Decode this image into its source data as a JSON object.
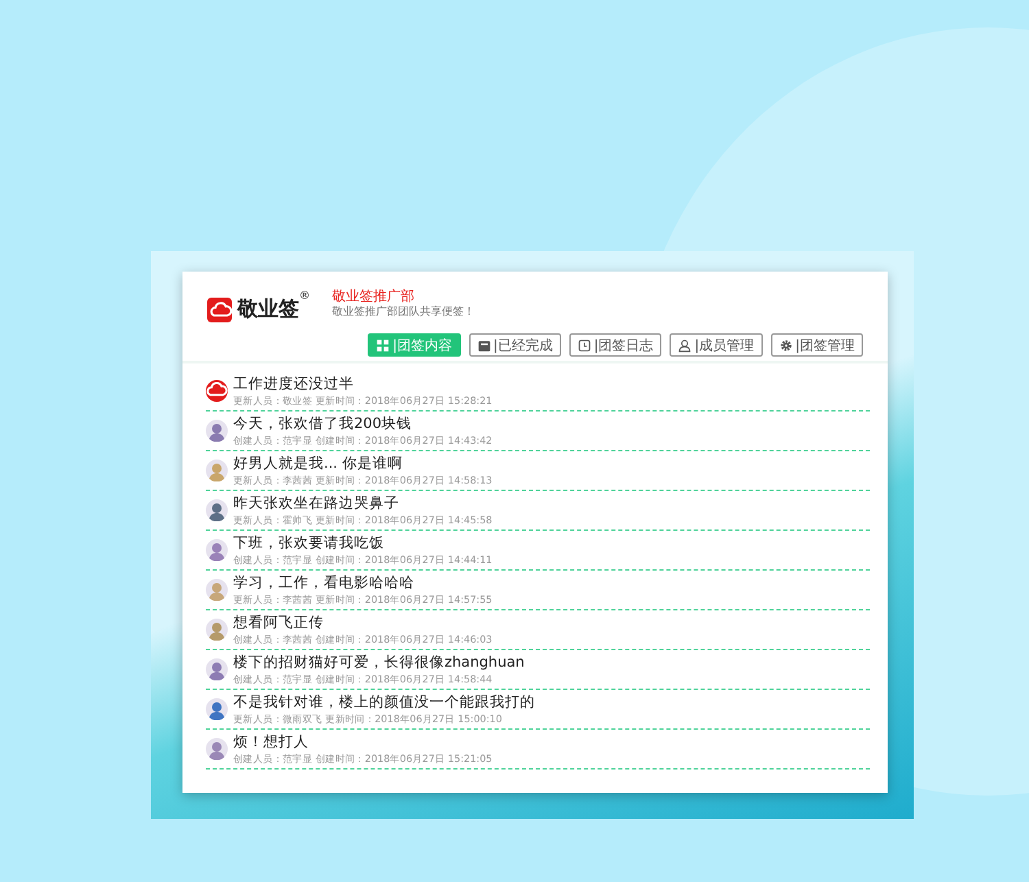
{
  "brand": {
    "name": "敬业签",
    "mark": "®",
    "team": "敬业签推广部",
    "slogan": "敬业签推广部团队共享便签！"
  },
  "tabs": [
    {
      "label": "|团签内容",
      "kind": "grid",
      "selected": true
    },
    {
      "label": "|已经完成",
      "kind": "box",
      "selected": false
    },
    {
      "label": "|团签日志",
      "kind": "log",
      "selected": false
    },
    {
      "label": "|成员管理",
      "kind": "user",
      "selected": false
    },
    {
      "label": "|团签管理",
      "kind": "gear",
      "selected": false
    }
  ],
  "notes": [
    {
      "title": "工作进度还没过半",
      "meta": "更新人员：敬业签 更新时间：2018年06月27日 15:28:21",
      "kind": "logo"
    },
    {
      "title": "今天，张欢借了我200块钱",
      "meta": "创建人员：范宇显 创建时间：2018年06月27日 14:43:42",
      "kind": "person"
    },
    {
      "title": "好男人就是我... 你是谁啊",
      "meta": "更新人员：李茜茜 更新时间：2018年06月27日 14:58:13",
      "kind": "person"
    },
    {
      "title": "昨天张欢坐在路边哭鼻子",
      "meta": "更新人员：霍帅飞 更新时间：2018年06月27日 14:45:58",
      "kind": "person"
    },
    {
      "title": "下班，张欢要请我吃饭",
      "meta": "创建人员：范宇显 创建时间：2018年06月27日 14:44:11",
      "kind": "person"
    },
    {
      "title": "学习，工作，看电影哈哈哈",
      "meta": "更新人员：李茜茜 更新时间：2018年06月27日 14:57:55",
      "kind": "person"
    },
    {
      "title": "想看阿飞正传",
      "meta": "创建人员：李茜茜 创建时间：2018年06月27日 14:46:03",
      "kind": "person"
    },
    {
      "title": "楼下的招财猫好可爱，长得很像zhanghuan",
      "meta": "创建人员：范宇显 创建时间：2018年06月27日 14:58:44",
      "kind": "person"
    },
    {
      "title": "不是我针对谁，楼上的颜值没一个能跟我打的",
      "meta": "更新人员：微雨双飞 更新时间：2018年06月27日 15:00:10",
      "kind": "person"
    },
    {
      "title": "烦！想打人",
      "meta": "创建人员：范宇显 创建时间：2018年06月27日 15:21:05",
      "kind": "person"
    }
  ]
}
